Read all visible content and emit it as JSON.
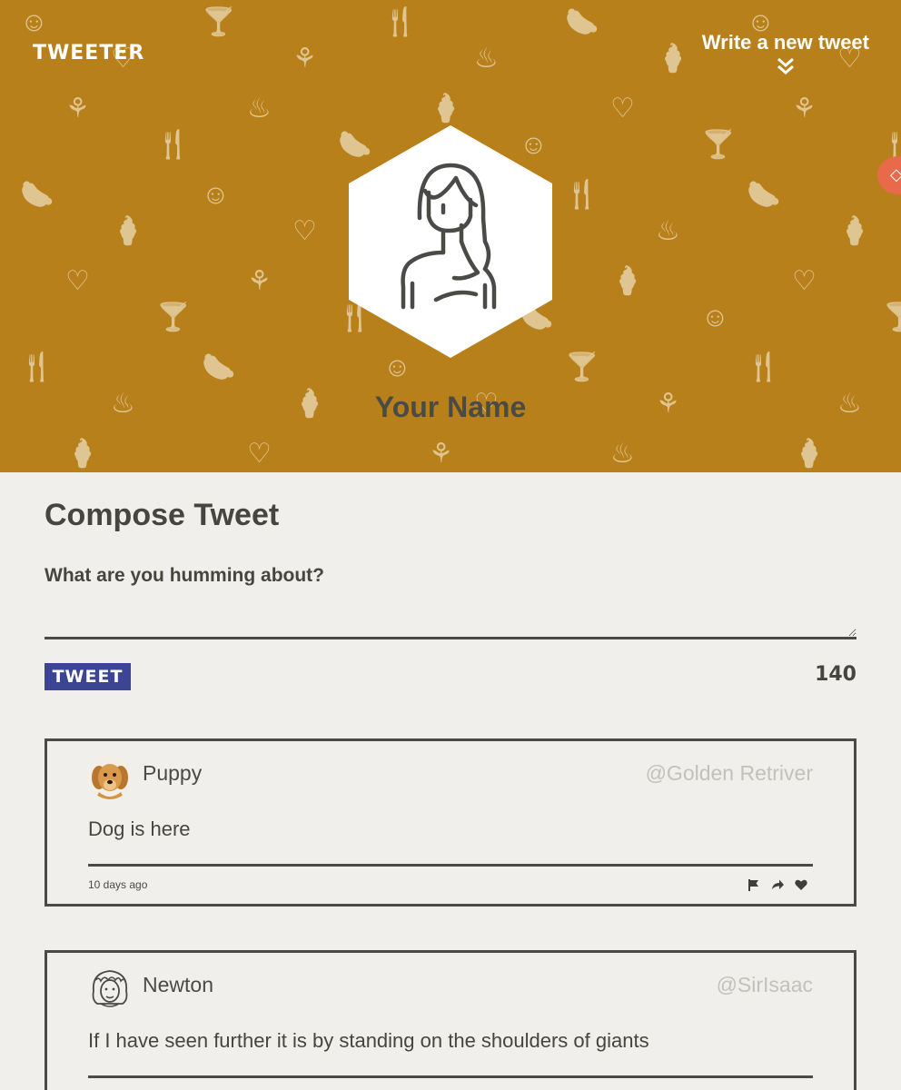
{
  "nav": {
    "brand": "TWEETER",
    "compose_toggle_label": "Write a new tweet",
    "compose_toggle_icon": "double-chevron-down-icon"
  },
  "profile": {
    "name": "Your Name",
    "avatar_icon": "woman-avatar-icon"
  },
  "compose": {
    "title": "Compose Tweet",
    "prompt": "What are you humming about?",
    "input_value": "",
    "button_label": "TWEET",
    "counter": "140"
  },
  "tweets": [
    {
      "name": "Puppy",
      "handle": "@Golden Retriver",
      "text": "Dog is here",
      "time": "10 days ago",
      "avatar_icon": "puppy-avatar-icon",
      "actions": [
        "flag-icon",
        "retweet-icon",
        "heart-icon"
      ]
    },
    {
      "name": "Newton",
      "handle": "@SirIsaac",
      "text": "If I have seen further it is by standing on the shoulders of giants",
      "avatar_icon": "newton-avatar-icon"
    }
  ],
  "colors": {
    "hero_background": "#b8801a",
    "pattern": "#e2c17d",
    "page_background": "#f0efeb",
    "tweet_button": "#3c4594",
    "text": "#4a4a46",
    "handle": "#c2c1bc",
    "side_badge": "#e86a4a"
  }
}
